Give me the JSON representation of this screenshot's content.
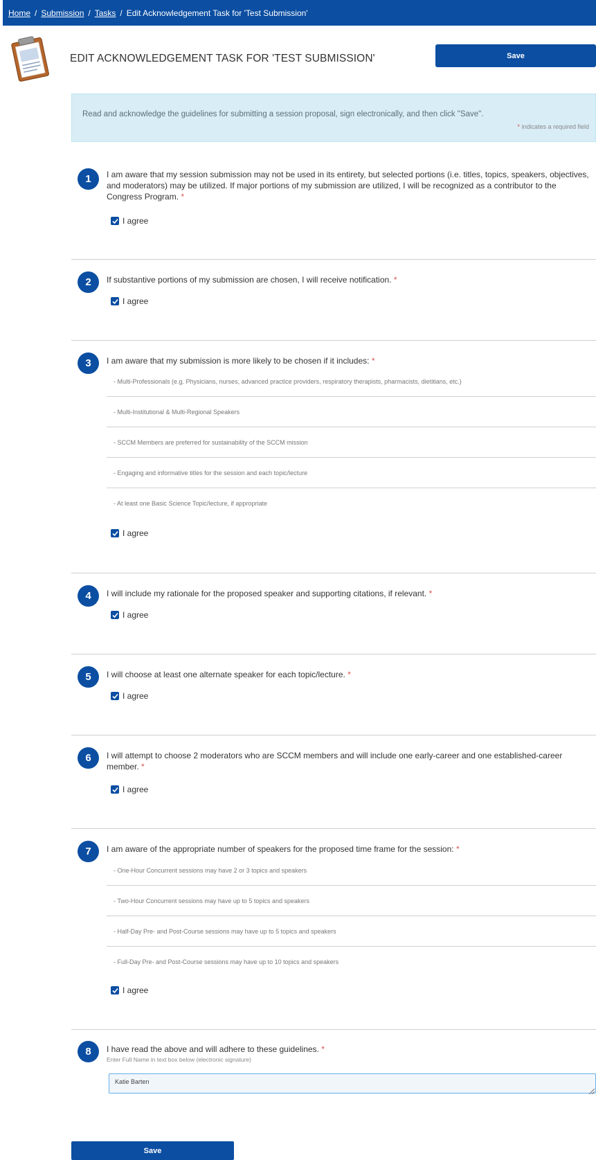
{
  "breadcrumb": {
    "items": [
      "Home",
      "Submission",
      "Tasks"
    ],
    "current": "Edit Acknowledgement Task for 'Test Submission'",
    "separator": "/"
  },
  "page": {
    "title": "EDIT ACKNOWLEDGEMENT TASK FOR 'TEST SUBMISSION'",
    "save_label": "Save",
    "save_bottom_label": "Save"
  },
  "info": {
    "message": "Read and acknowledge the guidelines for submitting a session proposal, sign electronically, and then click \"Save\".",
    "required_star": "*",
    "required_text": "indicates a required field"
  },
  "agree_label": "I agree",
  "required_star": "*",
  "questions": [
    {
      "number": "1",
      "text": "I am aware that my session submission may not be used in its entirety, but selected portions (i.e. titles, topics, speakers, objectives, and moderators) may be utilized. If major portions of my submission are utilized, I will be recognized as a contributor to the Congress Program.",
      "checked": true
    },
    {
      "number": "2",
      "text": "If substantive portions of my submission are chosen, I will receive notification.",
      "checked": true
    },
    {
      "number": "3",
      "text": "I am aware that my submission is more likely to be chosen if it includes:",
      "items": [
        "- Multi-Professionals (e.g. Physicians, nurses, advanced practice providers, respiratory therapists, pharmacists, dietitians, etc.)",
        "- Multi-Institutional & Multi-Regional Speakers",
        "- SCCM Members are preferred for sustainability of the SCCM mission",
        "- Engaging and informative titles for the session and each topic/lecture",
        "- At least one Basic Science Topic/lecture, if appropriate"
      ],
      "checked": true
    },
    {
      "number": "4",
      "text": "I will include my rationale for the proposed speaker and supporting citations, if relevant.",
      "checked": true
    },
    {
      "number": "5",
      "text": "I will choose at least one alternate speaker for each topic/lecture.",
      "checked": true
    },
    {
      "number": "6",
      "text": "I will attempt to choose 2 moderators who are SCCM members and will include one early-career and one established-career member.",
      "checked": true
    },
    {
      "number": "7",
      "text": "I am aware of the appropriate number of speakers for the proposed time frame for the session:",
      "items": [
        "- One-Hour Concurrent sessions may have 2 or 3 topics and speakers",
        "- Two-Hour Concurrent sessions may have up to 5 topics and speakers",
        "- Half-Day Pre- and Post-Course sessions may have up to 5 topics and speakers",
        "- Full-Day Pre- and Post-Course sessions may have up to 10 topics and speakers"
      ],
      "checked": true
    },
    {
      "number": "8",
      "text": "I have read the above and will adhere to these guidelines.",
      "hint": "Enter Full Name in text box below (electronic signature)",
      "signature_value": "Katie Barten"
    }
  ],
  "colors": {
    "primary": "#0b4ea2",
    "info_bg": "#d9edf7",
    "required": "#d9534f"
  },
  "icons": {
    "clipboard": "clipboard-icon",
    "checkbox": "checkbox-checked-icon",
    "resize": "resize-grip-icon"
  }
}
